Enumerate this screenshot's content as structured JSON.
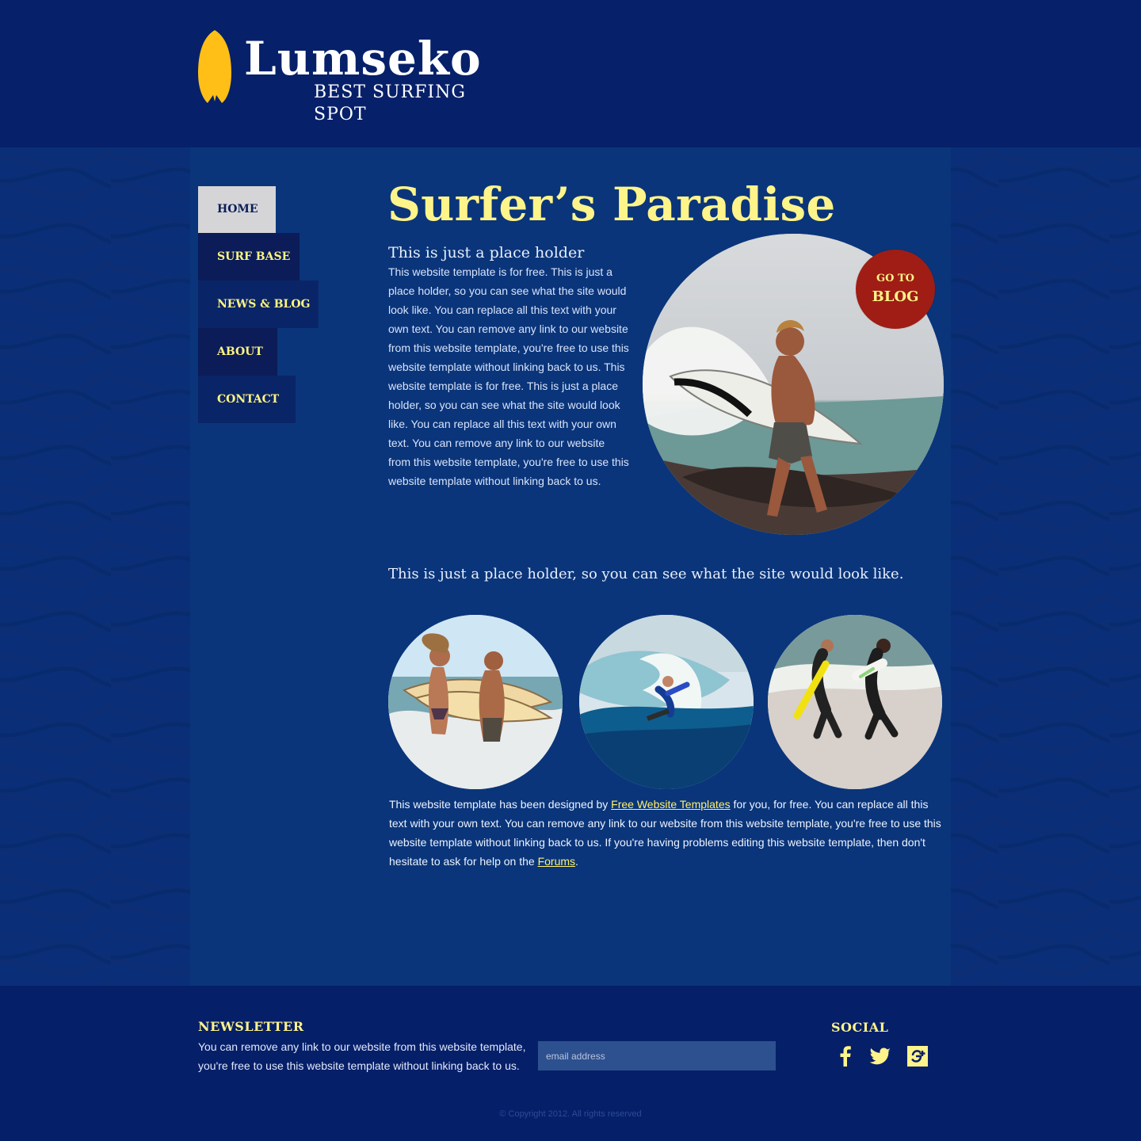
{
  "header": {
    "brand": "Lumseko",
    "tagline": "BEST SURFING SPOT",
    "logo_icon": "surfboard-logo-icon"
  },
  "nav": {
    "items": [
      {
        "label": "HOME"
      },
      {
        "label": "SURF BASE"
      },
      {
        "label": "NEWS & BLOG"
      },
      {
        "label": "ABOUT"
      },
      {
        "label": "CONTACT"
      }
    ]
  },
  "main": {
    "title": "Surfer’s Paradise",
    "intro_heading": "This is just a place holder",
    "intro_text": "This website template is for free. This is just a place holder, so you can see what the site would look like. You can replace all this text with your own text. You can remove any link to our website from this website template, you're free to use this website template without linking back to us. This website template is for free. This is just a place holder, so you can see what the site would look like. You can replace all this text with your own text. You can remove any link to our website from this website template, you're free to use this website template without linking back to us.",
    "blog_badge": {
      "small": "GO TO",
      "large": "BLOG"
    },
    "subheading": "This is just a place holder, so you can see what the site would look like.",
    "bottom_text_before_link": "This website template has been designed by ",
    "free_templates_link": "Free Website Templates",
    "bottom_text_middle": " for you, for free. You can replace all this text with your own text. You can remove any link to our website from this website template, you're free to use this website template without linking back to us. If you're having problems editing this website template, then don't hesitate to ask for help on the ",
    "forums_link": "Forums",
    "bottom_text_end": "."
  },
  "footer": {
    "newsletter_title": "NEWSLETTER",
    "newsletter_text": "You can remove any link to our website from this website template, you're free to use this website template without linking back to us.",
    "email_placeholder": "email address",
    "social_title": "SOCIAL",
    "copyright": "© Copyright 2012. All rights reserved"
  },
  "colors": {
    "background": "#0b2f78",
    "header": "#06206a",
    "accent_yellow": "#fff48a",
    "badge_red": "#9f1d14",
    "text": "#d8e3fb"
  },
  "icons": {
    "facebook": "facebook-icon",
    "twitter": "twitter-icon",
    "google": "google-plus-icon"
  }
}
